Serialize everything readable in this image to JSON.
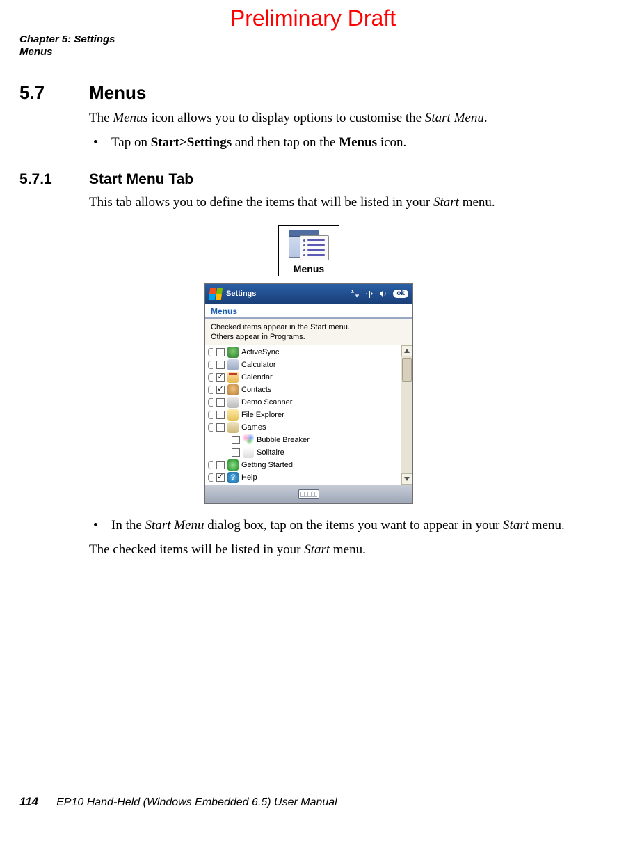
{
  "watermark": "Preliminary Draft",
  "header": {
    "chapter": "Chapter 5: Settings",
    "section": "Menus"
  },
  "section_5_7": {
    "number": "5.7",
    "title": "Menus",
    "intro_pre": "The ",
    "intro_em1": "Menus",
    "intro_mid": " icon allows you to display options to customise the ",
    "intro_em2": "Start Menu",
    "intro_post": ".",
    "bullet_bullet": "•",
    "bullet_pre": "Tap on ",
    "bullet_strong1": "Start>Settings",
    "bullet_mid": " and then tap on the ",
    "bullet_strong2": "Menus",
    "bullet_post": " icon."
  },
  "section_5_7_1": {
    "number": "5.7.1",
    "title": "Start Menu Tab",
    "intro_pre": "This tab allows you to define the items that will be listed in your ",
    "intro_em": "Start",
    "intro_post": " menu."
  },
  "menus_icon_label": "Menus",
  "screenshot": {
    "titlebar_label": "Settings",
    "ok_label": "ok",
    "tab_label": "Menus",
    "description_line1": "Checked items appear in the Start menu.",
    "description_line2": "Others appear in Programs.",
    "items": [
      {
        "label": "ActiveSync",
        "checked": false,
        "indent": false,
        "icon": "c1"
      },
      {
        "label": "Calculator",
        "checked": false,
        "indent": false,
        "icon": "c2"
      },
      {
        "label": "Calendar",
        "checked": true,
        "indent": false,
        "icon": "c3"
      },
      {
        "label": "Contacts",
        "checked": true,
        "indent": false,
        "icon": "c4"
      },
      {
        "label": "Demo Scanner",
        "checked": false,
        "indent": false,
        "icon": "c5"
      },
      {
        "label": "File Explorer",
        "checked": false,
        "indent": false,
        "icon": "c6"
      },
      {
        "label": "Games",
        "checked": false,
        "indent": false,
        "icon": "c7"
      },
      {
        "label": "Bubble Breaker",
        "checked": false,
        "indent": true,
        "icon": "c8"
      },
      {
        "label": "Solitaire",
        "checked": false,
        "indent": true,
        "icon": "c9"
      },
      {
        "label": "Getting Started",
        "checked": false,
        "indent": false,
        "icon": "c10"
      },
      {
        "label": "Help",
        "checked": true,
        "indent": false,
        "icon": "c11"
      }
    ]
  },
  "after_fig": {
    "bullet_bullet": "•",
    "b_pre": "In the ",
    "b_em1": "Start Menu",
    "b_mid": " dialog box, tap on the items you want to appear in your ",
    "b_em2": "Start",
    "b_post": " menu.",
    "p2_pre": "The checked items will be listed in your ",
    "p2_em": "Start",
    "p2_post": " menu."
  },
  "footer": {
    "page": "114",
    "manual": "EP10 Hand-Held (Windows Embedded 6.5) User Manual"
  }
}
